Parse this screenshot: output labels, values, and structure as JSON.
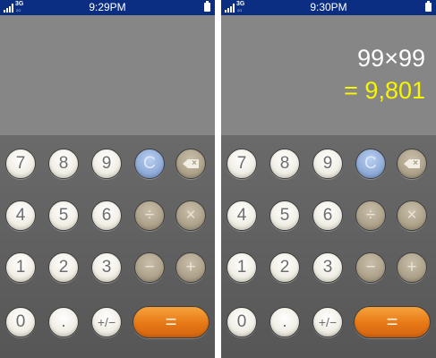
{
  "screens": [
    {
      "status": {
        "network": "3G",
        "network_sub": "2G",
        "time": "9:29PM"
      },
      "display": {
        "expression": "",
        "result": ""
      },
      "keys": {
        "k7": "7",
        "k8": "8",
        "k9": "9",
        "clear": "C",
        "k4": "4",
        "k5": "5",
        "k6": "6",
        "divide": "÷",
        "multiply": "×",
        "k1": "1",
        "k2": "2",
        "k3": "3",
        "minus": "−",
        "plus": "+",
        "k0": "0",
        "dot": ".",
        "sign": "+/−",
        "equals": "="
      }
    },
    {
      "status": {
        "network": "3G",
        "network_sub": "2G",
        "time": "9:30PM"
      },
      "display": {
        "expression": "99×99",
        "result": "= 9,801"
      },
      "keys": {
        "k7": "7",
        "k8": "8",
        "k9": "9",
        "clear": "C",
        "k4": "4",
        "k5": "5",
        "k6": "6",
        "divide": "÷",
        "multiply": "×",
        "k1": "1",
        "k2": "2",
        "k3": "3",
        "minus": "−",
        "plus": "+",
        "k0": "0",
        "dot": ".",
        "sign": "+/−",
        "equals": "="
      }
    }
  ],
  "colors": {
    "status_bar": "#0b2e82",
    "display_bg": "#868686",
    "result_text": "#f7f500",
    "clear_key": "#8fabd8",
    "operator_key": "#ada18a",
    "equals_key": "#e77816"
  },
  "icons": [
    "signal-bars-icon",
    "battery-icon",
    "backspace-icon"
  ]
}
